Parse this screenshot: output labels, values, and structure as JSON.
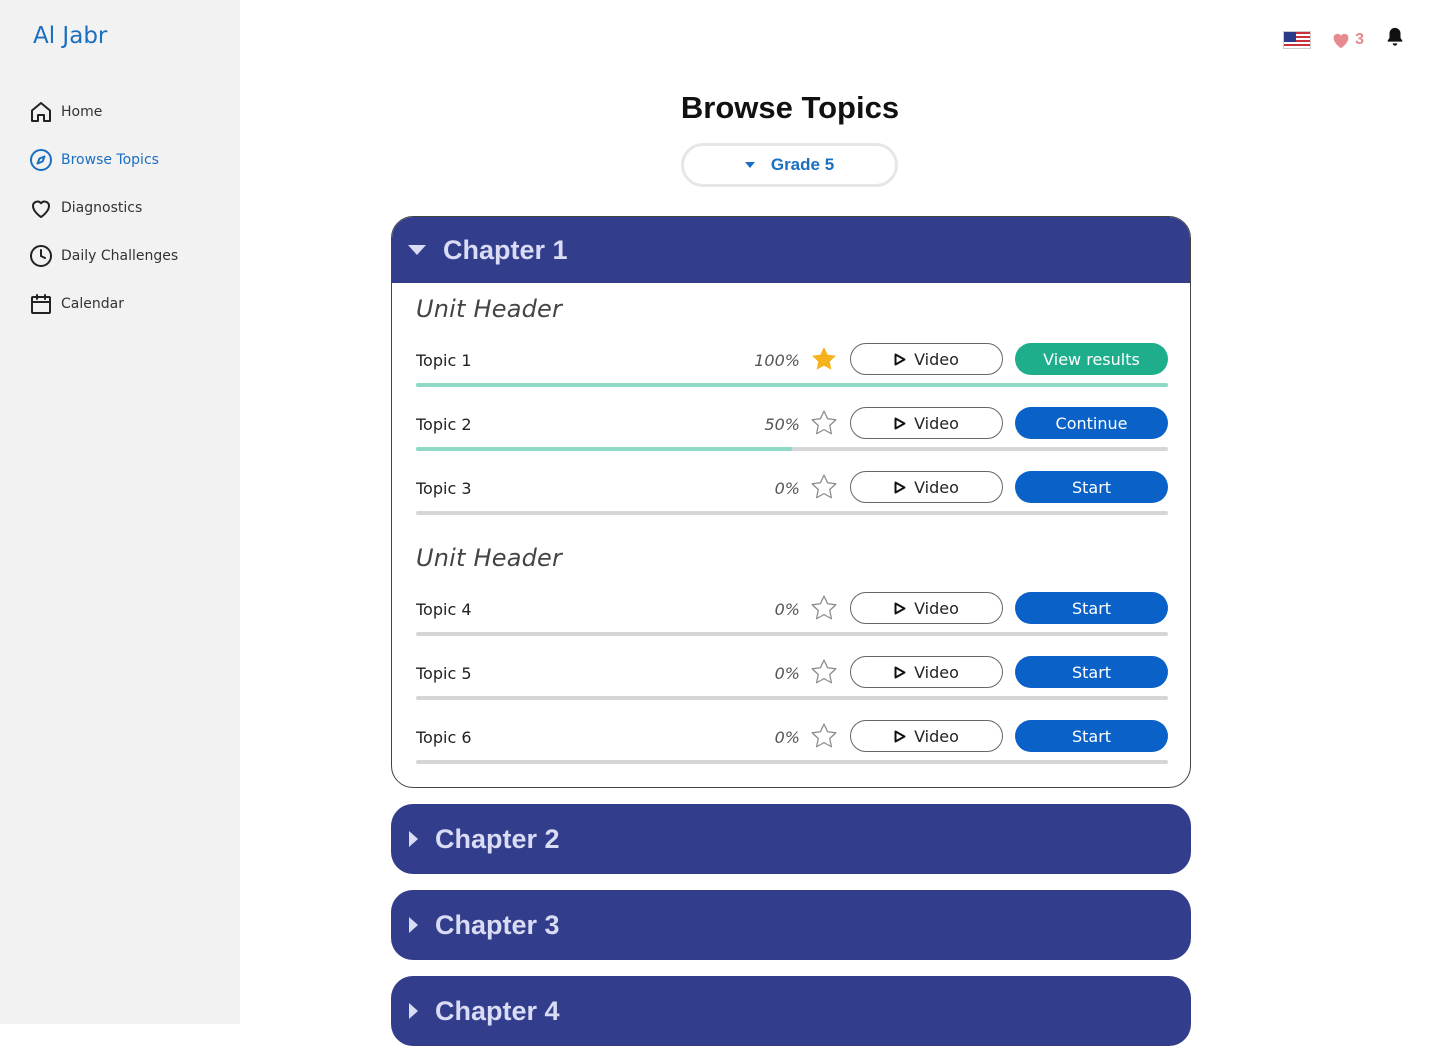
{
  "app": {
    "name": "Al Jabr"
  },
  "sidebar": {
    "items": [
      {
        "label": "Home",
        "icon": "home-icon",
        "active": false
      },
      {
        "label": "Browse Topics",
        "icon": "compass-icon",
        "active": true
      },
      {
        "label": "Diagnostics",
        "icon": "heart-outline-icon",
        "active": false
      },
      {
        "label": "Daily Challenges",
        "icon": "clock-icon",
        "active": false
      },
      {
        "label": "Calendar",
        "icon": "calendar-icon",
        "active": false
      }
    ]
  },
  "topbar": {
    "lives_count": "3",
    "flag": "us-flag-icon",
    "bell": "bell-icon"
  },
  "page": {
    "title": "Browse Topics",
    "grade_selected": "Grade 5"
  },
  "chapters": [
    {
      "label": "Chapter 1",
      "expanded": true,
      "units": [
        {
          "header": "Unit Header",
          "topics": [
            {
              "name": "Topic 1",
              "percent": "100%",
              "progress": 1.0,
              "starred": true,
              "video_label": "Video",
              "action_label": "View results",
              "action_style": "green"
            },
            {
              "name": "Topic 2",
              "percent": "50%",
              "progress": 0.5,
              "starred": false,
              "video_label": "Video",
              "action_label": "Continue",
              "action_style": "blue"
            },
            {
              "name": "Topic 3",
              "percent": "0%",
              "progress": 0.0,
              "starred": false,
              "video_label": "Video",
              "action_label": "Start",
              "action_style": "blue"
            }
          ]
        },
        {
          "header": "Unit Header",
          "topics": [
            {
              "name": "Topic 4",
              "percent": "0%",
              "progress": 0.0,
              "starred": false,
              "video_label": "Video",
              "action_label": "Start",
              "action_style": "blue"
            },
            {
              "name": "Topic 5",
              "percent": "0%",
              "progress": 0.0,
              "starred": false,
              "video_label": "Video",
              "action_label": "Start",
              "action_style": "blue"
            },
            {
              "name": "Topic 6",
              "percent": "0%",
              "progress": 0.0,
              "starred": false,
              "video_label": "Video",
              "action_label": "Start",
              "action_style": "blue"
            }
          ]
        }
      ]
    },
    {
      "label": "Chapter 2",
      "expanded": false
    },
    {
      "label": "Chapter 3",
      "expanded": false
    },
    {
      "label": "Chapter 4",
      "expanded": false
    }
  ],
  "colors": {
    "accent_blue": "#1a6fc1",
    "chapter_bg": "#323e8c",
    "button_blue": "#0a62c8",
    "button_green": "#1fae8b",
    "progress_fill": "#8fd8c8",
    "star_gold": "#f6b21b",
    "heart_pink": "#e58a8f"
  }
}
